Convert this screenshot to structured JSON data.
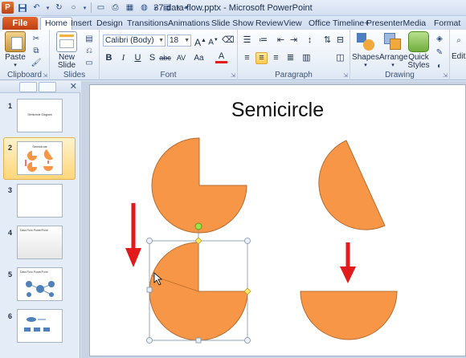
{
  "window": {
    "title": "37-data-flow.pptx - Microsoft PowerPoint",
    "app_logo": "P"
  },
  "tabs": {
    "file": "File",
    "items": [
      "Home",
      "Insert",
      "Design",
      "Transitions",
      "Animations",
      "Slide Show",
      "Review",
      "View",
      "Office Timeline+",
      "PresenterMedia",
      "Format"
    ],
    "active": "Home"
  },
  "ribbon": {
    "clipboard": {
      "label": "Clipboard",
      "paste": "Paste"
    },
    "slides": {
      "label": "Slides",
      "new_slide_line1": "New",
      "new_slide_line2": "Slide"
    },
    "font": {
      "label": "Font",
      "family": "Calibri (Body)",
      "size": "18"
    },
    "paragraph": {
      "label": "Paragraph"
    },
    "drawing": {
      "label": "Drawing",
      "shapes": "Shapes",
      "arrange": "Arrange",
      "quick_styles_line1": "Quick",
      "quick_styles_line2": "Styles"
    },
    "editing": {
      "label": "Editi"
    }
  },
  "slides": [
    {
      "num": "1",
      "caption": "Semicircle Diagram"
    },
    {
      "num": "2",
      "caption": "Semicircle"
    },
    {
      "num": "3",
      "caption": ""
    },
    {
      "num": "4",
      "caption": "Data Flow PowerPoint"
    },
    {
      "num": "5",
      "caption": "Data Flow PowerPoint"
    },
    {
      "num": "6",
      "caption": ""
    }
  ],
  "selected_slide": "2",
  "slide_content": {
    "title": "Semicircle",
    "shape_fill": "#f79646",
    "shape_stroke": "#b66d31",
    "arrow_color": "#e31a1c"
  }
}
